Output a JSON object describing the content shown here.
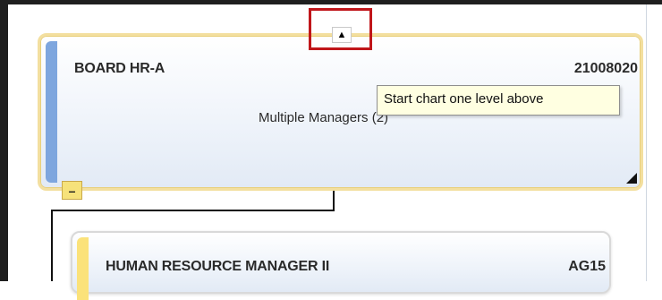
{
  "top_card": {
    "title": "BOARD HR-A",
    "code": "21008020",
    "managers": "Multiple Managers (2)"
  },
  "up_button": {
    "icon": "triangle-up-icon",
    "glyph": "▲"
  },
  "tooltip": {
    "text": "Start chart one level above"
  },
  "collapse_button": {
    "icon": "minus-icon",
    "glyph": "–"
  },
  "bottom_card": {
    "title": "HUMAN RESOURCE MANAGER II",
    "code": "AG15"
  },
  "colors": {
    "highlight": "#c0161a",
    "top_stripe": "#7ea6de",
    "top_border": "#f3df9f",
    "bottom_stripe": "#fbe27a",
    "tooltip_bg": "#ffffe1"
  }
}
